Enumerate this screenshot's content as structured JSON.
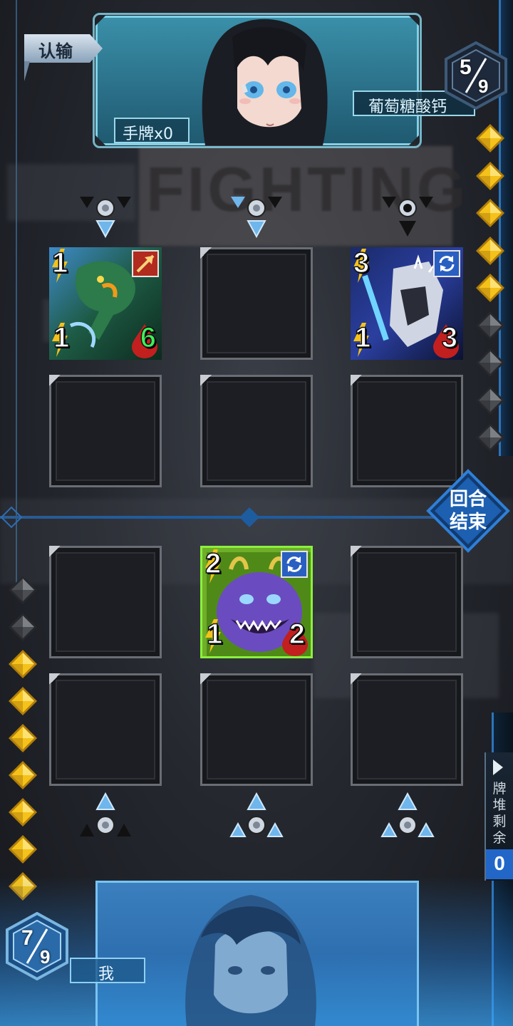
{
  "top_bar": {
    "surrender_label": "认输"
  },
  "opponent": {
    "name": "葡萄糖酸钙",
    "hand_label": "手牌x0",
    "mana_current": "5",
    "mana_max": "9",
    "crystals": [
      "full",
      "full",
      "full",
      "full",
      "full",
      "empty",
      "empty",
      "empty",
      "empty"
    ]
  },
  "player": {
    "name": "我",
    "mana_current": "7",
    "mana_max": "9",
    "crystals": [
      "empty",
      "empty",
      "full",
      "full",
      "full",
      "full",
      "full",
      "full",
      "full"
    ]
  },
  "board": {
    "opponent_cards": [
      {
        "cost": "1",
        "attack": "1",
        "health": "6",
        "art": "green-dragon",
        "badge": "arrow"
      },
      {
        "cost": "3",
        "attack": "1",
        "health": "3",
        "art": "silver-mech",
        "badge": "refresh"
      }
    ],
    "player_cards": [
      {
        "cost": "2",
        "attack": "1",
        "health": "2",
        "art": "purple-monster",
        "badge": "refresh"
      }
    ]
  },
  "controls": {
    "end_turn_line1": "回合",
    "end_turn_line2": "结束"
  },
  "deck": {
    "label": "牌堆剩余",
    "count": "0"
  },
  "background_text": "FIGHTING",
  "colors": {
    "accent": "#2266c8",
    "crystal_full": "#f4c21a",
    "crystal_empty": "#4a4d52",
    "panel_teal": "#2a6e87",
    "panel_blue": "#2e6fb0"
  }
}
